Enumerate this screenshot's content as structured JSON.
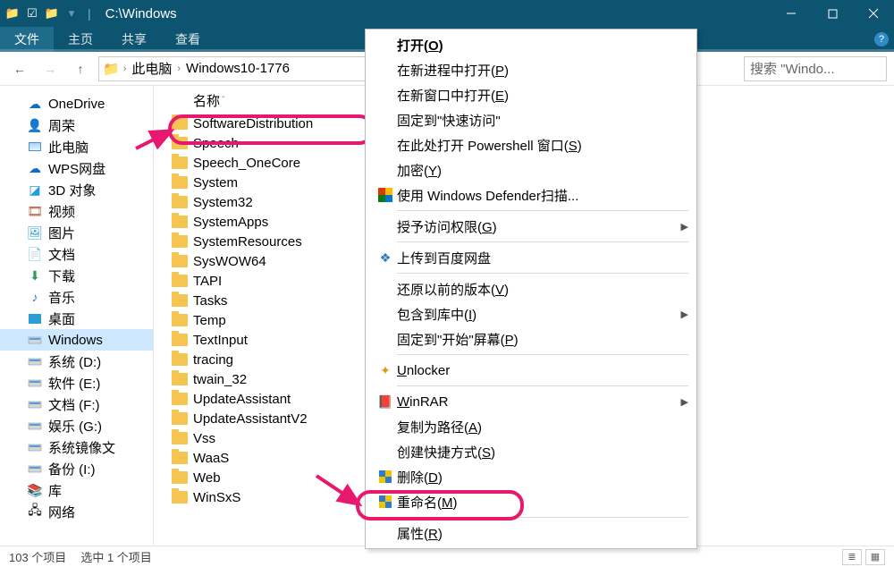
{
  "titlebar": {
    "title": "C:\\Windows"
  },
  "menubar": {
    "file": "文件",
    "tabs": [
      "主页",
      "共享",
      "查看"
    ]
  },
  "breadcrumb": {
    "items": [
      "此电脑",
      "Windows10-1776"
    ]
  },
  "search": {
    "placeholder": "搜索 \"Windo..."
  },
  "tree": {
    "items": [
      {
        "label": "OneDrive",
        "icon": "cloud"
      },
      {
        "label": "周荣",
        "icon": "user"
      },
      {
        "label": "此电脑",
        "icon": "pc"
      },
      {
        "label": "WPS网盘",
        "icon": "cloud"
      },
      {
        "label": "3D 对象",
        "icon": "3d"
      },
      {
        "label": "视频",
        "icon": "video"
      },
      {
        "label": "图片",
        "icon": "pic"
      },
      {
        "label": "文档",
        "icon": "doc"
      },
      {
        "label": "下载",
        "icon": "dl"
      },
      {
        "label": "音乐",
        "icon": "music"
      },
      {
        "label": "桌面",
        "icon": "desk"
      },
      {
        "label": "Windows",
        "icon": "disk",
        "selected": true
      },
      {
        "label": "系统 (D:)",
        "icon": "disk"
      },
      {
        "label": "软件 (E:)",
        "icon": "disk"
      },
      {
        "label": "文档 (F:)",
        "icon": "disk"
      },
      {
        "label": "娱乐 (G:)",
        "icon": "disk"
      },
      {
        "label": "系统镜像文",
        "icon": "disk"
      },
      {
        "label": "备份 (I:)",
        "icon": "disk"
      },
      {
        "label": "库",
        "icon": "lib"
      },
      {
        "label": "网络",
        "icon": "net"
      }
    ]
  },
  "column_header": "名称",
  "files": [
    "SoftwareDistribution",
    "Speech",
    "Speech_OneCore",
    "System",
    "System32",
    "SystemApps",
    "SystemResources",
    "SysWOW64",
    "TAPI",
    "Tasks",
    "Temp",
    "TextInput",
    "tracing",
    "twain_32",
    "UpdateAssistant",
    "UpdateAssistantV2",
    "Vss",
    "WaaS",
    "Web",
    "WinSxS"
  ],
  "highlighted_file_index": 0,
  "context_menu": {
    "groups": [
      [
        {
          "label": "打开",
          "accel": "O",
          "bold": true
        },
        {
          "label": "在新进程中打开",
          "accel": "P"
        },
        {
          "label": "在新窗口中打开",
          "accel": "E"
        },
        {
          "label": "固定到\"快速访问\""
        },
        {
          "label": "在此处打开 Powershell 窗口",
          "accel": "S"
        },
        {
          "label": "加密",
          "accel": "Y"
        },
        {
          "label": "使用 Windows Defender扫描...",
          "icon": "defender"
        }
      ],
      [
        {
          "label": "授予访问权限",
          "accel": "G",
          "submenu": true
        }
      ],
      [
        {
          "label": "上传到百度网盘",
          "icon": "baidu"
        }
      ],
      [
        {
          "label": "还原以前的版本",
          "accel": "V"
        },
        {
          "label": "包含到库中",
          "accel": "I",
          "submenu": true
        },
        {
          "label": "固定到\"开始\"屏幕",
          "accel": "P"
        }
      ],
      [
        {
          "label": "Unlocker",
          "icon": "unlocker",
          "und_first": true
        }
      ],
      [
        {
          "label": "WinRAR",
          "icon": "winrar",
          "submenu": true,
          "und_first": true
        },
        {
          "label": "复制为路径",
          "accel": "A"
        },
        {
          "label": "创建快捷方式",
          "accel": "S"
        },
        {
          "label": "删除",
          "accel": "D",
          "icon": "shield"
        },
        {
          "label": "重命名",
          "accel": "M",
          "icon": "shield",
          "highlight": true
        }
      ],
      [
        {
          "label": "属性",
          "accel": "R"
        }
      ]
    ]
  },
  "status": {
    "count": "103 个项目",
    "sel": "选中 1 个项目"
  }
}
